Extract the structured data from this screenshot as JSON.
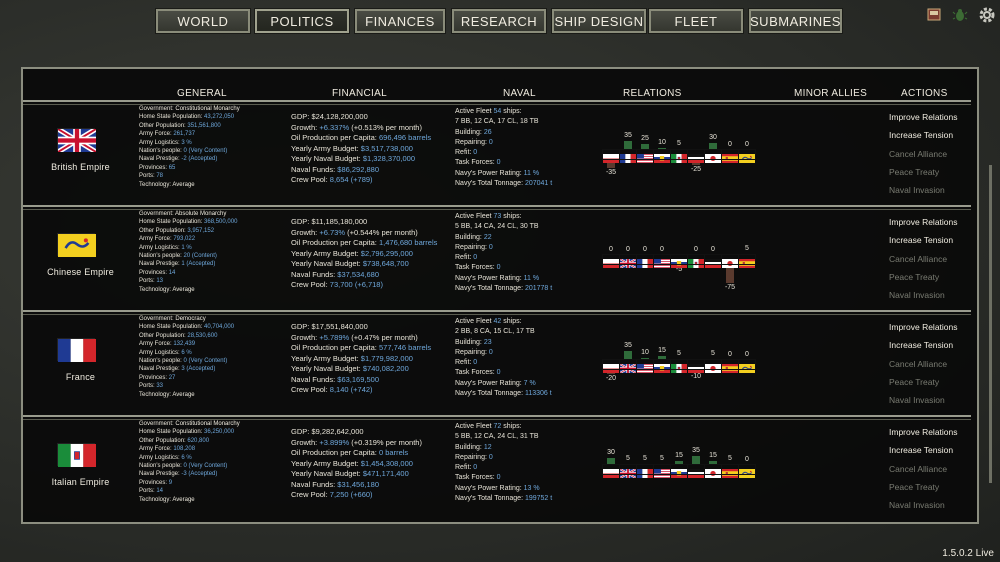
{
  "nav": {
    "tabs": [
      {
        "label": "WORLD",
        "active": false
      },
      {
        "label": "POLITICS",
        "active": true
      },
      {
        "label": "FINANCES",
        "active": false
      },
      {
        "label": "RESEARCH",
        "active": false
      },
      {
        "label": "SHIP DESIGN",
        "active": false
      },
      {
        "label": "FLEET",
        "active": false
      },
      {
        "label": "SUBMARINES",
        "active": false
      }
    ],
    "icons": [
      "flag-icon",
      "bug-icon",
      "gear-icon"
    ]
  },
  "headers": {
    "general": "GENERAL",
    "financial": "FINANCIAL",
    "naval": "NAVAL",
    "relations": "RELATIONS",
    "minor_allies": "MINOR ALLIES",
    "actions": "ACTIONS"
  },
  "version": "1.5.0.2 Live",
  "colors": {
    "value_blue": "#6fa8dc",
    "disabled": "#7a7c72",
    "panel_border": "#8c8e80"
  },
  "nations": [
    {
      "name": "British Empire",
      "flag": "uk",
      "general": {
        "government": "Constitutional Monarchy",
        "home_pop": "43,272,050",
        "other_pop": "351,561,800",
        "army_force": "261,737",
        "army_logistics": "3 %",
        "nations_people": "0 (Very Content)",
        "naval_prestige": "-2 (Accepted)",
        "provinces": "65",
        "ports": "78",
        "technology": "Average"
      },
      "financial": {
        "gdp": "$24,128,200,000",
        "growth": "+6.337%",
        "growth_extra": "(+0.513% per month)",
        "oil": "696,496 barrels",
        "army_budget": "$3,517,738,000",
        "naval_budget": "$1,328,370,000",
        "naval_funds": "$86,292,880",
        "crew_pool": "8,654",
        "crew_change": "(+789)"
      },
      "naval": {
        "fleet_count": "54",
        "composition": "7 BB, 12 CA, 17 CL, 18 TB",
        "building": "26",
        "repairing": "0",
        "refit": "0",
        "task_forces": "0",
        "power_rating": "11 %",
        "tonnage": "207041 t"
      },
      "relations": [
        {
          "flag": "austria",
          "value": -35
        },
        {
          "flag": "france",
          "value": 35
        },
        {
          "flag": "usa",
          "value": 25
        },
        {
          "flag": "russia",
          "value": 10
        },
        {
          "flag": "italy",
          "value": 5
        },
        {
          "flag": "germany",
          "value": -25
        },
        {
          "flag": "japan",
          "value": 30
        },
        {
          "flag": "spain",
          "value": 0
        },
        {
          "flag": "china",
          "value": 0
        }
      ],
      "actions": [
        {
          "label": "Improve Relations",
          "enabled": true
        },
        {
          "label": "Increase Tension",
          "enabled": true
        },
        {
          "label": "Cancel Alliance",
          "enabled": false
        },
        {
          "label": "Peace Treaty",
          "enabled": false
        },
        {
          "label": "Naval Invasion",
          "enabled": false
        }
      ]
    },
    {
      "name": "Chinese Empire",
      "flag": "china",
      "general": {
        "government": "Absolute Monarchy",
        "home_pop": "368,500,000",
        "other_pop": "3,957,152",
        "army_force": "793,022",
        "army_logistics": "1 %",
        "nations_people": "20 (Content)",
        "naval_prestige": "1 (Accepted)",
        "provinces": "14",
        "ports": "13",
        "technology": "Average"
      },
      "financial": {
        "gdp": "$11,185,180,000",
        "growth": "+6.73%",
        "growth_extra": "(+0.544% per month)",
        "oil": "1,476,680 barrels",
        "army_budget": "$2,796,295,000",
        "naval_budget": "$738,648,700",
        "naval_funds": "$37,534,680",
        "crew_pool": "73,700",
        "crew_change": "(+6,718)"
      },
      "naval": {
        "fleet_count": "73",
        "composition": "5 BB, 14 CA, 24 CL, 30 TB",
        "building": "22",
        "repairing": "0",
        "refit": "0",
        "task_forces": "0",
        "power_rating": "11 %",
        "tonnage": "201778 t"
      },
      "relations": [
        {
          "flag": "austria",
          "value": 0
        },
        {
          "flag": "uk",
          "value": 0
        },
        {
          "flag": "france",
          "value": 0
        },
        {
          "flag": "usa",
          "value": 0
        },
        {
          "flag": "russia",
          "value": -5
        },
        {
          "flag": "italy",
          "value": 0
        },
        {
          "flag": "germany",
          "value": 0
        },
        {
          "flag": "japan",
          "value": -75
        },
        {
          "flag": "spain",
          "value": 5
        }
      ],
      "actions": [
        {
          "label": "Improve Relations",
          "enabled": true
        },
        {
          "label": "Increase Tension",
          "enabled": true
        },
        {
          "label": "Cancel Alliance",
          "enabled": false
        },
        {
          "label": "Peace Treaty",
          "enabled": false
        },
        {
          "label": "Naval Invasion",
          "enabled": false
        }
      ]
    },
    {
      "name": "France",
      "flag": "france",
      "general": {
        "government": "Democracy",
        "home_pop": "40,704,000",
        "other_pop": "28,530,600",
        "army_force": "132,439",
        "army_logistics": "6 %",
        "nations_people": "0 (Very Content)",
        "naval_prestige": "3 (Accepted)",
        "provinces": "27",
        "ports": "33",
        "technology": "Average"
      },
      "financial": {
        "gdp": "$17,551,840,000",
        "growth": "+5.789%",
        "growth_extra": "(+0.47% per month)",
        "oil": "577,746 barrels",
        "army_budget": "$1,779,982,000",
        "naval_budget": "$740,082,200",
        "naval_funds": "$63,169,500",
        "crew_pool": "8,140",
        "crew_change": "(+742)"
      },
      "naval": {
        "fleet_count": "42",
        "composition": "2 BB, 8 CA, 15 CL, 17 TB",
        "building": "23",
        "repairing": "0",
        "refit": "0",
        "task_forces": "0",
        "power_rating": "7 %",
        "tonnage": "113306 t"
      },
      "relations": [
        {
          "flag": "austria",
          "value": -20
        },
        {
          "flag": "uk",
          "value": 35
        },
        {
          "flag": "usa",
          "value": 10
        },
        {
          "flag": "russia",
          "value": 15
        },
        {
          "flag": "italy",
          "value": 5
        },
        {
          "flag": "germany",
          "value": -10
        },
        {
          "flag": "japan",
          "value": 5
        },
        {
          "flag": "spain",
          "value": 0
        },
        {
          "flag": "china",
          "value": 0
        }
      ],
      "actions": [
        {
          "label": "Improve Relations",
          "enabled": true
        },
        {
          "label": "Increase Tension",
          "enabled": true
        },
        {
          "label": "Cancel Alliance",
          "enabled": false
        },
        {
          "label": "Peace Treaty",
          "enabled": false
        },
        {
          "label": "Naval Invasion",
          "enabled": false
        }
      ]
    },
    {
      "name": "Italian Empire",
      "flag": "italy",
      "general": {
        "government": "Constitutional Monarchy",
        "home_pop": "36,250,000",
        "other_pop": "620,800",
        "army_force": "108,208",
        "army_logistics": "6 %",
        "nations_people": "0 (Very Content)",
        "naval_prestige": "-3 (Accepted)",
        "provinces": "9",
        "ports": "14",
        "technology": "Average"
      },
      "financial": {
        "gdp": "$9,282,642,000",
        "growth": "+3.899%",
        "growth_extra": "(+0.319% per month)",
        "oil": "0 barrels",
        "army_budget": "$1,454,308,000",
        "naval_budget": "$471,171,400",
        "naval_funds": "$31,456,180",
        "crew_pool": "7,250",
        "crew_change": "(+660)"
      },
      "naval": {
        "fleet_count": "72",
        "composition": "5 BB, 12 CA, 24 CL, 31 TB",
        "building": "12",
        "repairing": "0",
        "refit": "0",
        "task_forces": "0",
        "power_rating": "13 %",
        "tonnage": "199752 t"
      },
      "relations": [
        {
          "flag": "austria",
          "value": 30
        },
        {
          "flag": "uk",
          "value": 5
        },
        {
          "flag": "france",
          "value": 5
        },
        {
          "flag": "usa",
          "value": 5
        },
        {
          "flag": "russia",
          "value": 15
        },
        {
          "flag": "germany",
          "value": 35
        },
        {
          "flag": "japan",
          "value": 15
        },
        {
          "flag": "spain",
          "value": 5
        },
        {
          "flag": "china",
          "value": 0
        }
      ],
      "actions": [
        {
          "label": "Improve Relations",
          "enabled": true
        },
        {
          "label": "Increase Tension",
          "enabled": true
        },
        {
          "label": "Cancel Alliance",
          "enabled": false
        },
        {
          "label": "Peace Treaty",
          "enabled": false
        },
        {
          "label": "Naval Invasion",
          "enabled": false
        }
      ]
    }
  ],
  "labels": {
    "government": "Government:",
    "home_pop": "Home State Population:",
    "other_pop": "Other Population:",
    "army_force": "Army Force:",
    "army_logistics": "Army Logistics:",
    "nations_people": "Nation's people:",
    "naval_prestige": "Naval Prestige:",
    "provinces": "Provinces:",
    "ports": "Ports:",
    "technology": "Technology:",
    "gdp": "GDP:",
    "growth": "Growth:",
    "oil": "Oil Production per Capita:",
    "army_budget": "Yearly Army Budget:",
    "naval_budget": "Yearly Naval Budget:",
    "naval_funds": "Naval Funds:",
    "crew_pool": "Crew Pool:",
    "active_fleet": "Active Fleet",
    "ships": "ships:",
    "building": "Building:",
    "repairing": "Repairing:",
    "refit": "Refit:",
    "task_forces": "Task Forces:",
    "power_rating": "Navy's Power Rating:",
    "tonnage": "Navy's Total Tonnage:"
  }
}
